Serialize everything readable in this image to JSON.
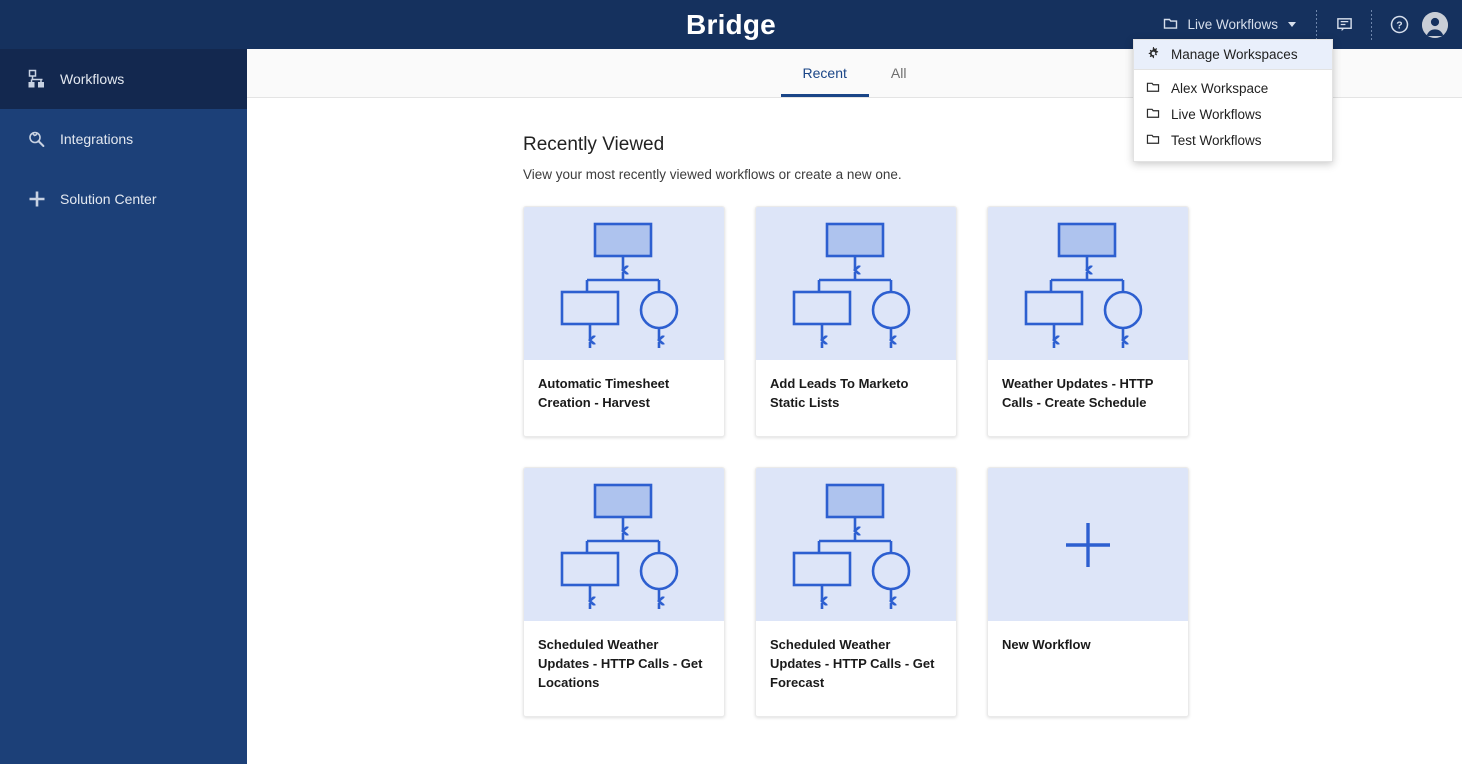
{
  "header": {
    "title": "Bridge",
    "workspace_switcher": {
      "label": "Live Workflows",
      "icon": "workspace-folder-icon",
      "caret": "chevron-down-icon"
    },
    "icons": [
      {
        "name": "feedback-icon",
        "label": "Feedback"
      },
      {
        "name": "help-icon",
        "label": "Help"
      },
      {
        "name": "user-avatar-icon",
        "label": "Account"
      }
    ],
    "colors": {
      "bar": "#15315E",
      "text": "#FFFFFF"
    }
  },
  "workspace_menu": {
    "manage": {
      "label": "Manage Workspaces",
      "icon": "gear-icon",
      "highlighted": true
    },
    "items": [
      {
        "label": "Alex Workspace",
        "icon": "folder-icon"
      },
      {
        "label": "Live Workflows",
        "icon": "folder-icon"
      },
      {
        "label": "Test Workflows",
        "icon": "folder-icon"
      }
    ]
  },
  "sidebar": {
    "background": "#1C4078",
    "active_background": "#13284F",
    "items": [
      {
        "label": "Workflows",
        "icon": "sitemap-icon",
        "active": true
      },
      {
        "label": "Integrations",
        "icon": "plug-icon",
        "active": false
      },
      {
        "label": "Solution Center",
        "icon": "plus-icon",
        "active": false
      }
    ]
  },
  "main": {
    "tabs": [
      {
        "label": "Recent",
        "active": true
      },
      {
        "label": "All",
        "active": false
      }
    ],
    "section": {
      "title": "Recently Viewed",
      "subtitle": "View your most recently viewed workflows or create a new one."
    },
    "cards": [
      {
        "title": "Automatic Timesheet Creation - Harvest",
        "thumb": "workflow-diagram"
      },
      {
        "title": "Add Leads To Marketo Static Lists",
        "thumb": "workflow-diagram"
      },
      {
        "title": "Weather Updates - HTTP Calls - Create Schedule",
        "thumb": "workflow-diagram"
      },
      {
        "title": "Scheduled Weather Updates - HTTP Calls - Get Locations",
        "thumb": "workflow-diagram"
      },
      {
        "title": "Scheduled Weather Updates - HTTP Calls - Get Forecast",
        "thumb": "workflow-diagram"
      },
      {
        "title": "New Workflow",
        "thumb": "plus-icon"
      }
    ],
    "colors": {
      "thumb_background": "#DDE5F8",
      "diagram_stroke": "#2D5FD0",
      "diagram_fill": "#AEC3EE",
      "accent": "#1A4587"
    }
  }
}
